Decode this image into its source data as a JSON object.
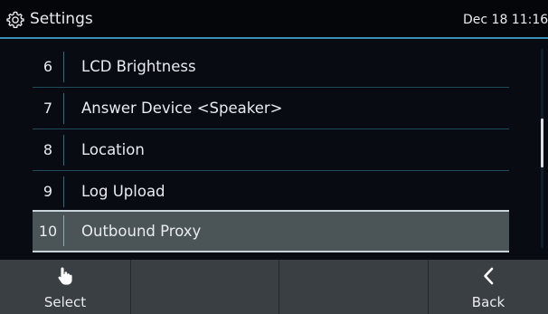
{
  "header": {
    "title": "Settings",
    "icon": "gear-icon",
    "clock": "Dec 18 11:16"
  },
  "list": {
    "items": [
      {
        "index": "6",
        "label": "LCD Brightness"
      },
      {
        "index": "7",
        "label": "Answer Device <Speaker>"
      },
      {
        "index": "8",
        "label": "Location"
      },
      {
        "index": "9",
        "label": "Log Upload"
      },
      {
        "index": "10",
        "label": "Outbound Proxy",
        "selected": true
      }
    ]
  },
  "softkeys": {
    "select": {
      "label": "Select",
      "icon": "hand-pointer-icon"
    },
    "back": {
      "label": "Back",
      "icon": "chevron-left-icon"
    }
  },
  "colors": {
    "background": "#080b12",
    "header_border": "#3a8fb8",
    "selected_row": "#4b5457",
    "softkey_bar": "#3a3f43",
    "text": "#e8ebef"
  }
}
